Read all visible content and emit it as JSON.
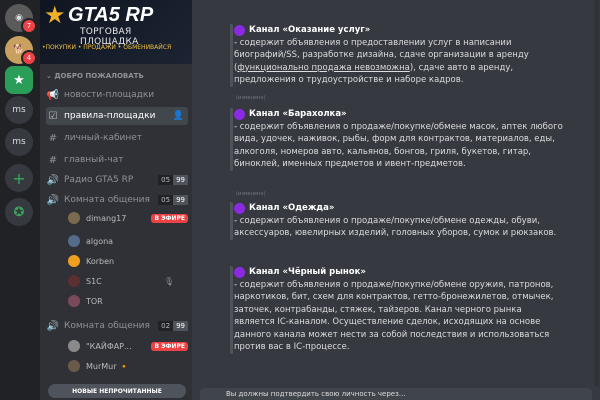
{
  "rail": {
    "items": [
      {
        "label": "",
        "badge": "7"
      },
      {
        "label": "",
        "badge": "4"
      },
      {
        "label": "",
        "badge": ""
      },
      {
        "label": "ms",
        "badge": ""
      },
      {
        "label": "ms",
        "badge": ""
      },
      {
        "label": "+",
        "badge": ""
      },
      {
        "label": "",
        "badge": ""
      }
    ]
  },
  "banner": {
    "title": "GTA5 RP",
    "subtitle": "ТОРГОВАЯ ПЛОЩАДКА",
    "tagline": "•ПОКУПКИ • ПРОДАЖИ • ОБМЕНИВАЙСЯ"
  },
  "category": "ДОБРО ПОЖАЛОВАТЬ",
  "channels": [
    {
      "label": "новости-площадки",
      "icon": "megaphone-icon"
    },
    {
      "label": "правила-площадки",
      "icon": "checkbox-icon"
    },
    {
      "label": "личный-кабинет",
      "icon": "hash-icon"
    },
    {
      "label": "главный-чат",
      "icon": "hash-icon"
    }
  ],
  "voice": [
    {
      "label": "Радио GTA5 RP",
      "count": "05",
      "limit": "99"
    },
    {
      "label": "Комната общения",
      "count": "05",
      "limit": "99"
    },
    {
      "label": "Комната общения",
      "count": "02",
      "limit": "99"
    }
  ],
  "room1_users": [
    {
      "name": "dimang17",
      "live": "В ЭФИРЕ",
      "color": "#7a6a4f"
    },
    {
      "name": "algona",
      "live": "",
      "color": "#556b8a"
    },
    {
      "name": "Korben",
      "live": "",
      "color": "#f0a020"
    },
    {
      "name": "S1C",
      "live": "",
      "color": "#5a3030"
    },
    {
      "name": "TOR",
      "live": "",
      "color": "#7a4a5a"
    }
  ],
  "room2_users": [
    {
      "name": "\"КАЙФАР...",
      "live": "В ЭФИРЕ",
      "color": "#8a8a8a"
    },
    {
      "name": "MurMur 🔸",
      "live": "",
      "color": "#6a5a4a"
    }
  ],
  "new_unread": "НОВЫЕ НЕПРОЧИТАННЫЕ",
  "messages": [
    {
      "title": "Канал «Оказание услуг»",
      "body": "- содержит объявления о предоставлении услуг в написании биографий/SS, разработке дизайна, сдаче организации в аренду (",
      "link": "функционально продажа невозможна",
      "body2": "), сдаче авто в аренду, предложения о трудоустройстве и наборе кадров."
    },
    {
      "title": "Канал «Барахолка»",
      "body": "- содержит объявления о продаже/покупке/обмене масок, аптек любого вида, удочек, наживок, рыбы, форм для контрактов, материалов, еды, алкоголя, номеров авто, кальянов, бонгов, гриля, букетов, гитар, биноклей, именных предметов и ивент-предметов."
    },
    {
      "title": "Канал «Одежда»",
      "body": "- содержит объявления о продаже/покупке/обмене одежды, обуви, аксессуаров, ювелирных изделий, головных уборов, сумок и рюкзаков."
    },
    {
      "title": "Канал «Чёрный рынок»",
      "body": "- содержит объявления о продаже/покупке/обмене оружия, патронов, наркотиков, бит, схем для контрактов, гетто-бронежилетов, отмычек, заточек, контрабанды, стяжек, тайзеров. Канал черного рынка является IC-каналом. Осуществление сделок, исходящих на основе данного канала может нести за собой последствия и использоваться против вас в IC-процессе."
    }
  ],
  "edited": "(изменено)",
  "input_notice": "Вы должны подтвердить свою личность через..."
}
